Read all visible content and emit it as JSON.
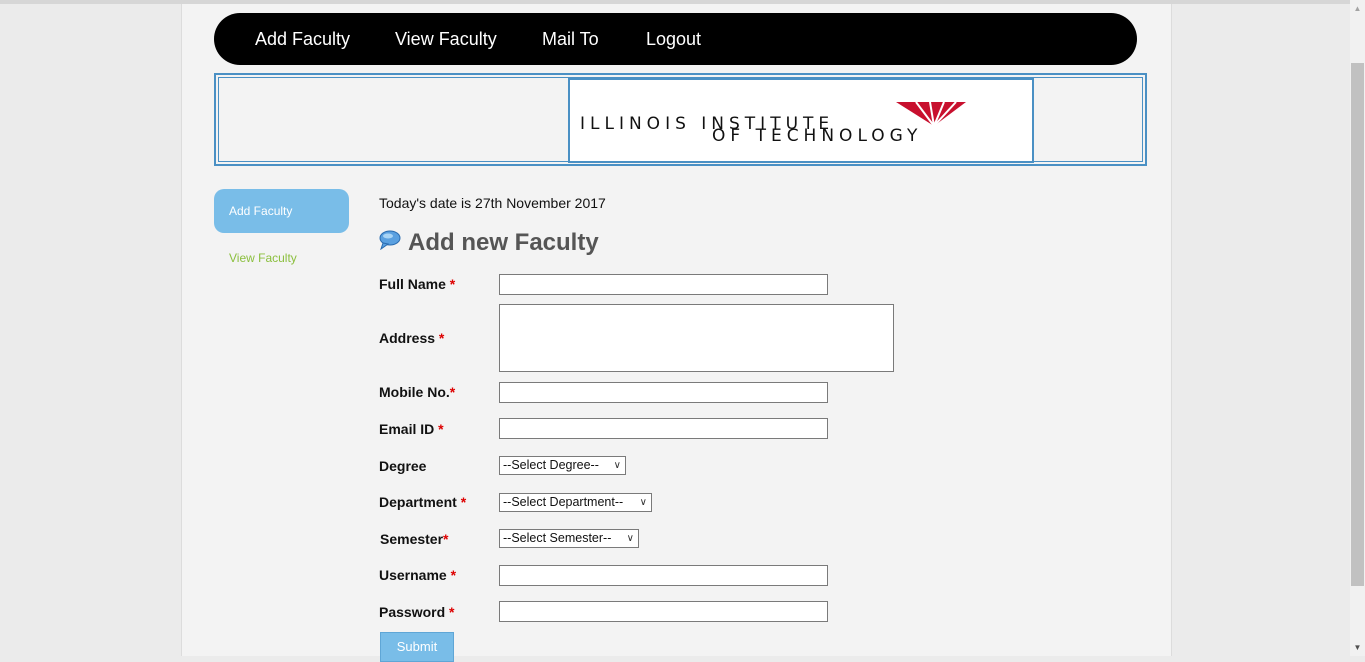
{
  "nav": {
    "items": [
      {
        "label": "Add Faculty"
      },
      {
        "label": "View Faculty"
      },
      {
        "label": "Mail To"
      },
      {
        "label": "Logout"
      }
    ]
  },
  "banner": {
    "logo_line1": "ILLINOIS INSTITUTE",
    "logo_line2": "OF TECHNOLOGY"
  },
  "sidebar": {
    "active": "Add Faculty",
    "link": "View Faculty"
  },
  "main": {
    "date_text": "Today's date is 27th November 2017",
    "form_title": "Add new Faculty"
  },
  "form": {
    "full_name": {
      "label": "Full Name",
      "required": "*",
      "value": ""
    },
    "address": {
      "label": "Address",
      "required": "*",
      "value": ""
    },
    "mobile": {
      "label": "Mobile No.",
      "required": "*",
      "value": ""
    },
    "email": {
      "label": "Email ID",
      "required": "*",
      "value": ""
    },
    "degree": {
      "label": "Degree",
      "selected": "--Select Degree--"
    },
    "department": {
      "label": "Department",
      "required": "*",
      "selected": "--Select Department--"
    },
    "semester": {
      "label": "Semester",
      "required": "*",
      "selected": "--Select Semester--"
    },
    "username": {
      "label": "Username",
      "required": "*",
      "value": ""
    },
    "password": {
      "label": "Password",
      "required": "*",
      "value": ""
    },
    "submit_label": "Submit"
  },
  "colors": {
    "nav_bg": "#000000",
    "accent_blue": "#79bde8",
    "banner_border": "#4a90c4",
    "sidebar_link": "#8bbf3e",
    "required": "#dd0000",
    "logo_red": "#c8102e"
  }
}
